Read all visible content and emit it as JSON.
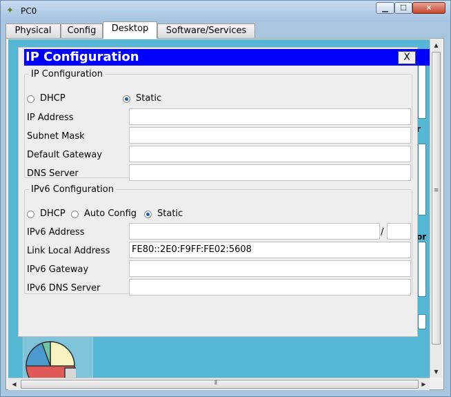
{
  "window": {
    "title": "PC0",
    "minimize": "▁",
    "maximize": "☐",
    "close": "✕"
  },
  "tabs": [
    {
      "label": "Physical"
    },
    {
      "label": "Config"
    },
    {
      "label": "Desktop",
      "active": true
    },
    {
      "label": "Software/Services"
    }
  ],
  "dialog": {
    "title": "IP Configuration",
    "close_label": "X",
    "ipv4": {
      "legend": "IP Configuration",
      "dhcp_label": "DHCP",
      "static_label": "Static",
      "mode": "static",
      "fields": {
        "ip_address": {
          "label": "IP Address",
          "value": ""
        },
        "subnet_mask": {
          "label": "Subnet Mask",
          "value": ""
        },
        "default_gateway": {
          "label": "Default Gateway",
          "value": ""
        },
        "dns_server": {
          "label": "DNS Server",
          "value": ""
        }
      }
    },
    "ipv6": {
      "legend": "IPv6 Configuration",
      "dhcp_label": "DHCP",
      "auto_label": "Auto Config",
      "static_label": "Static",
      "mode": "static",
      "prefix_separator": "/",
      "fields": {
        "ipv6_address": {
          "label": "IPv6 Address",
          "value": "",
          "prefix": ""
        },
        "link_local": {
          "label": "Link Local Address",
          "value": "FE80::2E0:F9FF:FE02:5608"
        },
        "ipv6_gateway": {
          "label": "IPv6 Gateway",
          "value": ""
        },
        "ipv6_dns": {
          "label": "IPv6 DNS Server",
          "value": ""
        }
      }
    }
  },
  "desktop": {
    "side_text_1": "r",
    "side_text_2": "or"
  },
  "colors": {
    "dialog_title_bg": "#0000ff",
    "desktop_bg": "#55b7d3",
    "radio_selected": "#1a5fb4"
  }
}
